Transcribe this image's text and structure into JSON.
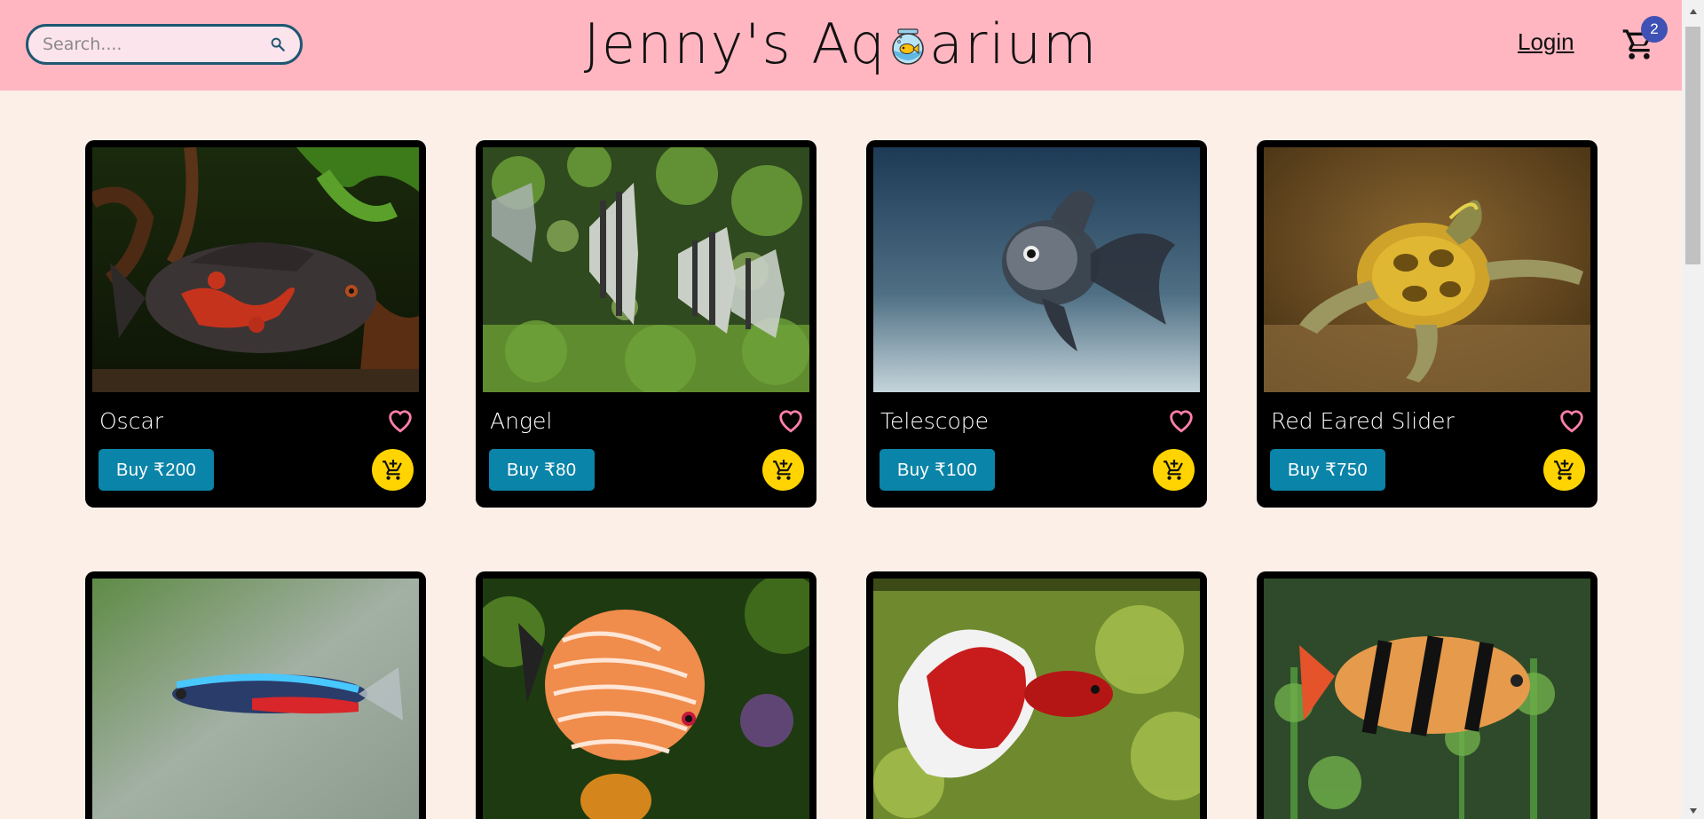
{
  "header": {
    "search_placeholder": "Search....",
    "brand_left": "Jenny's Aq",
    "brand_right": "arium",
    "login_label": "Login",
    "cart_count": "2"
  },
  "colors": {
    "header_bg": "#ffb6c1",
    "page_bg": "#fcefe8",
    "buy_button": "#0a84a8",
    "cart_button": "#ffd400",
    "heart": "#ff7fa8",
    "badge": "#3f51b5"
  },
  "icons": {
    "search": "search-icon",
    "cart": "shopping-cart-icon",
    "heart": "heart-outline-icon",
    "add_cart": "add-shopping-cart-icon",
    "logo_bowl": "fishbowl-icon"
  },
  "products": [
    {
      "name": "Oscar",
      "buy_label": "Buy ₹200"
    },
    {
      "name": "Angel",
      "buy_label": "Buy ₹80"
    },
    {
      "name": "Telescope",
      "buy_label": "Buy ₹100"
    },
    {
      "name": "Red Eared Slider",
      "buy_label": "Buy ₹750"
    },
    {
      "name": "",
      "buy_label": ""
    },
    {
      "name": "",
      "buy_label": ""
    },
    {
      "name": "",
      "buy_label": ""
    },
    {
      "name": "",
      "buy_label": ""
    }
  ]
}
